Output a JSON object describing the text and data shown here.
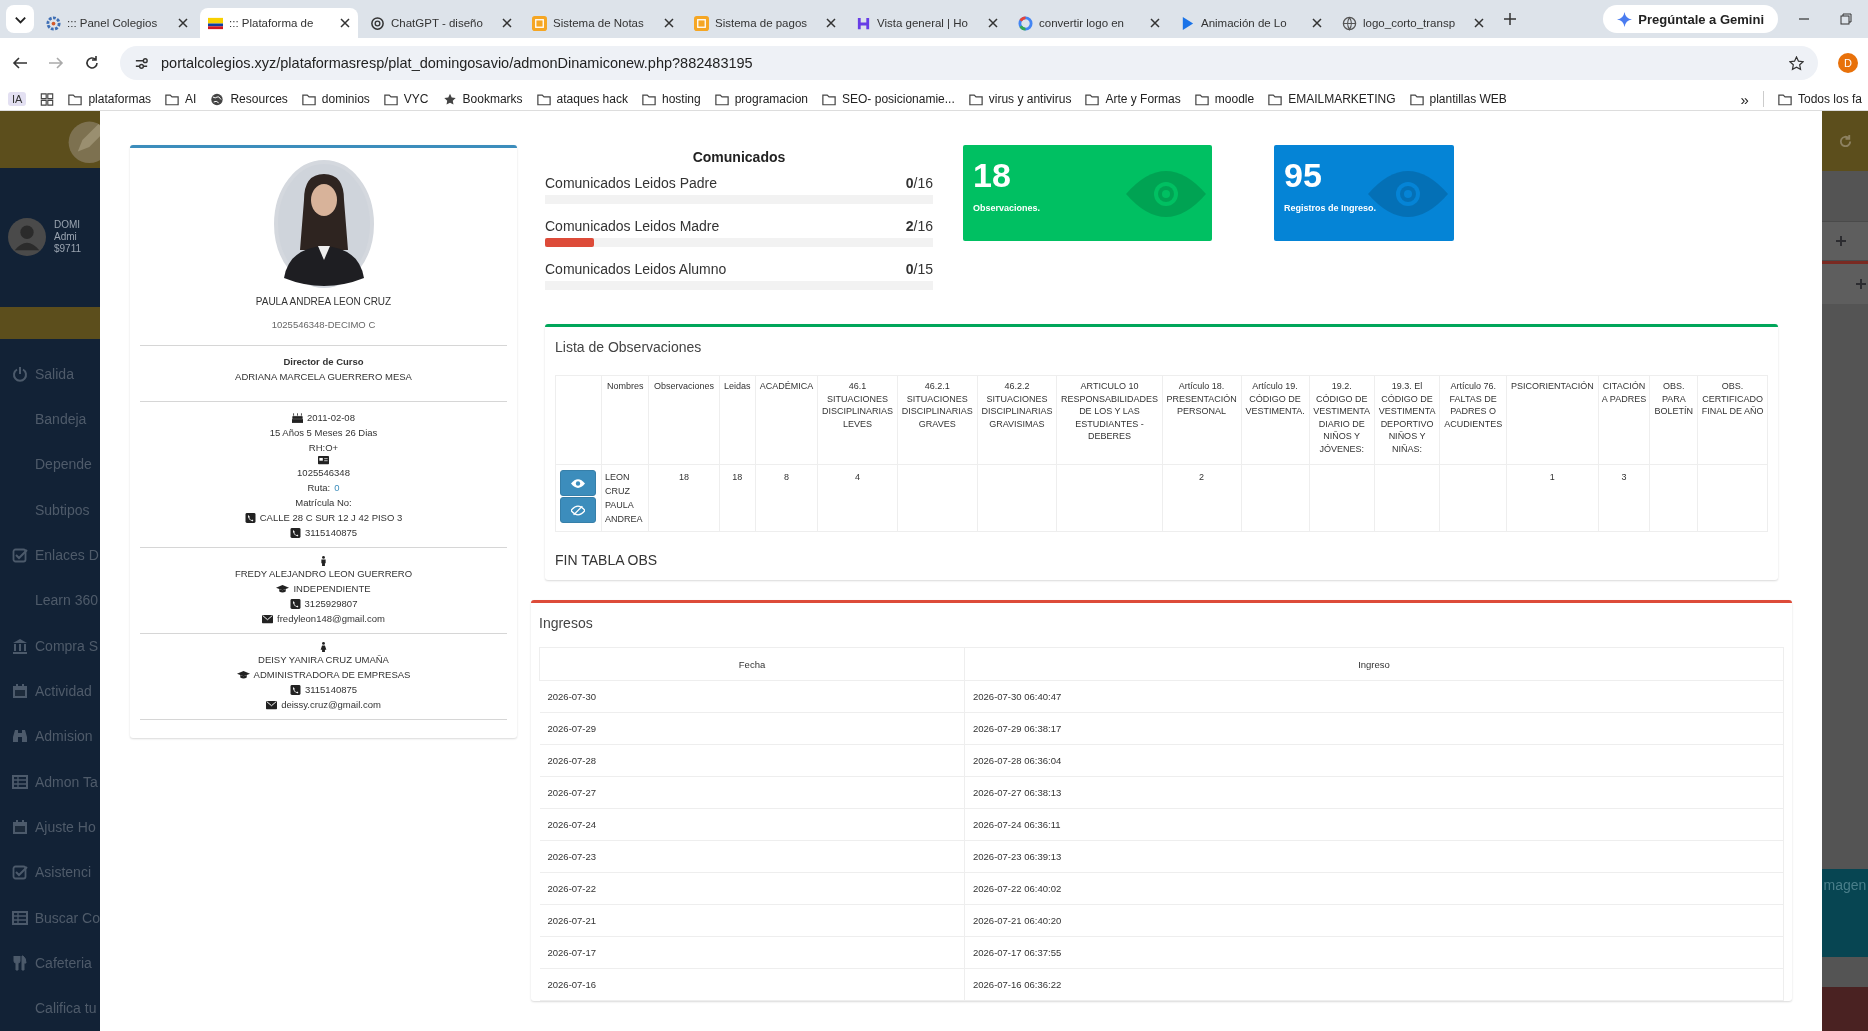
{
  "browser": {
    "tabs": [
      {
        "title": "::: Panel Colegios",
        "kind": "gear",
        "selected": false
      },
      {
        "title": "::: Plataforma de",
        "kind": "flag",
        "selected": true
      },
      {
        "title": "ChatGPT - diseño",
        "kind": "knot",
        "selected": false
      },
      {
        "title": "Sistema de Notas",
        "kind": "square",
        "selected": false
      },
      {
        "title": "Sistema de pagos",
        "kind": "square",
        "selected": false
      },
      {
        "title": "Vista general | Ho",
        "kind": "letter",
        "selected": false
      },
      {
        "title": "convertir logo en",
        "kind": "ring",
        "selected": false
      },
      {
        "title": "Animación de Lo",
        "kind": "play",
        "selected": false
      },
      {
        "title": "logo_corto_transp",
        "kind": "globe",
        "selected": false
      }
    ],
    "gemini_button": "Pregúntale a Gemini",
    "url": "portalcolegios.xyz/plataformasresp/plat_domingosavio/admonDinamiconew.php?882483195",
    "profile_initial": "D",
    "ai_badge": "IA",
    "bookmarks": [
      {
        "label": "plataformas",
        "kind": "folder"
      },
      {
        "label": "AI",
        "kind": "folder"
      },
      {
        "label": "Resources",
        "kind": "site"
      },
      {
        "label": "dominios",
        "kind": "folder"
      },
      {
        "label": "VYC",
        "kind": "folder"
      },
      {
        "label": "Bookmarks",
        "kind": "starred"
      },
      {
        "label": "ataques hack",
        "kind": "folder"
      },
      {
        "label": "hosting",
        "kind": "folder"
      },
      {
        "label": "programacion",
        "kind": "folder"
      },
      {
        "label": "SEO- posicionamie...",
        "kind": "folder"
      },
      {
        "label": "virus y antivirus",
        "kind": "folder"
      },
      {
        "label": "Arte y Formas",
        "kind": "folder"
      },
      {
        "label": "moodle",
        "kind": "folder"
      },
      {
        "label": "EMAILMARKETING",
        "kind": "folder"
      },
      {
        "label": "plantillas WEB",
        "kind": "folder"
      }
    ],
    "overflow": "»",
    "other_bookmarks": "Todos los fa"
  },
  "background": {
    "user_name": "DOMI",
    "user_role": "Admi",
    "user_balance": "$9711",
    "menu": [
      {
        "label": "Salida",
        "kind": "power"
      },
      {
        "label": "Bandeja",
        "kind": "sub"
      },
      {
        "label": "Depende",
        "kind": "sub"
      },
      {
        "label": "Subtipos",
        "kind": "sub"
      },
      {
        "label": "Enlaces D",
        "kind": "check"
      },
      {
        "label": "Learn 360",
        "kind": "sub"
      },
      {
        "label": "Compra S",
        "kind": "bank"
      },
      {
        "label": "Actividad",
        "kind": "calendar"
      },
      {
        "label": "Admision",
        "kind": "binoculars"
      },
      {
        "label": "Admon Ta",
        "kind": "table"
      },
      {
        "label": "Ajuste Ho",
        "kind": "calendar"
      },
      {
        "label": "Asistenci",
        "kind": "check"
      },
      {
        "label": "Buscar Co",
        "kind": "table"
      },
      {
        "label": "Cafeteria",
        "kind": "utensils"
      },
      {
        "label": "Califica tu",
        "kind": "sub"
      }
    ],
    "right_panel_text": "magen"
  },
  "student": {
    "name": "PAULA ANDREA LEON CRUZ",
    "id_course": "1025546348-DECIMO C",
    "director_heading": "Director de Curso",
    "director": "ADRIANA MARCELA GUERRERO MESA",
    "birthdate": "2011-02-08",
    "age": "15 Años 5 Meses 26 Dias",
    "blood": "RH:O+",
    "document": "1025546348",
    "route_label": "Ruta:",
    "route": "0",
    "enrollment": "Matrícula No:",
    "address": "CALLE 28 C SUR 12 J 42 PISO 3",
    "phone": "3115140875",
    "parents": [
      {
        "kind": "father",
        "name": "FREDY ALEJANDRO LEON GUERRERO",
        "occupation": "INDEPENDIENTE",
        "phone": "3125929807",
        "email": "fredyleon148@gmail.com"
      },
      {
        "kind": "mother",
        "name": "DEISY YANIRA CRUZ UMAÑA",
        "occupation": "ADMINISTRADORA DE EMPRESAS",
        "phone": "3115140875",
        "email": "deissy.cruz@gmail.com"
      }
    ]
  },
  "comunicados": {
    "title": "Comunicados",
    "rows": [
      {
        "label": "Comunicados Leidos Padre",
        "count": "**0**/16",
        "level": 0
      },
      {
        "label": "Comunicados Leidos Madre",
        "count": "**2**/16",
        "level": 0.125
      },
      {
        "label": "Comunicados Leidos Alumno",
        "count": "**0**/15",
        "level": 0
      }
    ]
  },
  "tiles": [
    {
      "number": "18",
      "label": "Observaciones.",
      "color": "#00c062"
    },
    {
      "number": "95",
      "label": "Registros de Ingreso.",
      "color": "#0584d6"
    }
  ],
  "observations": {
    "title": "Lista de Observaciones",
    "columns": [
      "Nombres",
      "Observaciones",
      "Leidas",
      "ACADÉMICA",
      "46.1 SITUACIONES DISCIPLINARIAS LEVES",
      "46.2.1 SITUACIONES DISCIPLINARIAS GRAVES",
      "46.2.2 SITUACIONES DISCIPLINARIAS GRAVISIMAS",
      "ARTICULO 10 RESPONSABILIDADES DE LOS Y LAS ESTUDIANTES - DEBERES",
      "Artículo 18. PRESENTACIÓN PERSONAL",
      "Artículo 19. CÓDIGO DE VESTIMENTA.",
      "19.2. CÓDIGO DE VESTIMENTA DIARIO DE NIÑOS Y JÓVENES:",
      "19.3. El CÓDIGO DE VESTIMENTA DEPORTIVO NIÑOS Y NIÑAS:",
      "Artículo 76. FALTAS DE PADRES O ACUDIENTES",
      "PSICORIENTACIÓN",
      "CITACIÓN A PADRES",
      "OBS. PARA BOLETÍN",
      "OBS. CERTIFICADO FINAL DE AÑO"
    ],
    "rows": [
      {
        "actions": [
          {
            "kind": "view"
          },
          {
            "kind": "hide"
          }
        ],
        "cells": [
          "LEON CRUZ PAULA ANDREA",
          "18",
          "18",
          "8",
          "4",
          null,
          null,
          null,
          "2",
          null,
          null,
          null,
          null,
          "1",
          "3",
          null,
          null
        ]
      }
    ],
    "footer": "FIN TABLA OBS"
  },
  "ingresos": {
    "title": "Ingresos",
    "columns": [
      "Fecha",
      "Ingreso"
    ],
    "rows": [
      [
        "2026-07-30",
        "2026-07-30 06:40:47"
      ],
      [
        "2026-07-29",
        "2026-07-29 06:38:17"
      ],
      [
        "2026-07-28",
        "2026-07-28 06:36:04"
      ],
      [
        "2026-07-27",
        "2026-07-27 06:38:13"
      ],
      [
        "2026-07-24",
        "2026-07-24 06:36:11"
      ],
      [
        "2026-07-23",
        "2026-07-23 06:39:13"
      ],
      [
        "2026-07-22",
        "2026-07-22 06:40:02"
      ],
      [
        "2026-07-21",
        "2026-07-21 06:40:20"
      ],
      [
        "2026-07-17",
        "2026-07-17 06:37:55"
      ],
      [
        "2026-07-16",
        "2026-07-16 06:36:22"
      ]
    ]
  }
}
